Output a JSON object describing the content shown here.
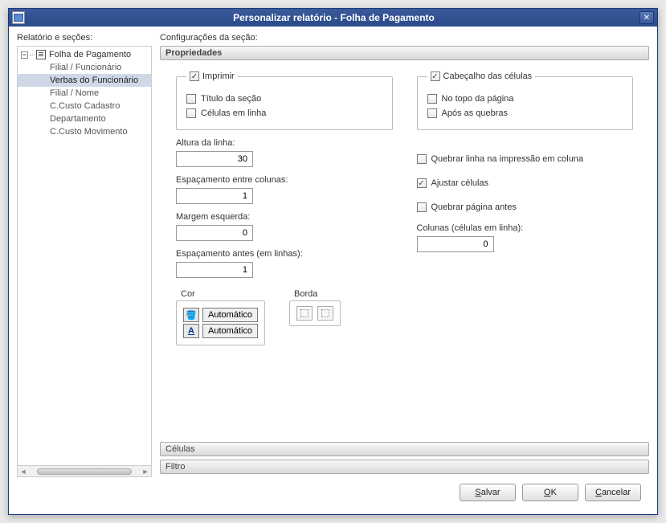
{
  "title": "Personalizar relatório - Folha de Pagamento",
  "labels": {
    "left_header": "Relatório e seções:",
    "right_header": "Configurações da seção:"
  },
  "tree": {
    "root": "Folha de Pagamento",
    "items": [
      "Filial / Funcionário",
      "Verbas do Funcionário",
      "Filial / Nome",
      "C.Custo Cadastro",
      "Departamento",
      "C.Custo Movimento"
    ],
    "selected_index": 1
  },
  "sections": {
    "propriedades": "Propriedades",
    "celulas": "Células",
    "filtro": "Filtro"
  },
  "imprimir": {
    "legend": "Imprimir",
    "titulo": "Título da seção",
    "celulas_linha": "Células em linha"
  },
  "cabecalho": {
    "legend": "Cabeçalho das células",
    "topo": "No topo da página",
    "apos": "Após as quebras"
  },
  "fields": {
    "altura_lbl": "Altura da linha:",
    "altura_val": "30",
    "esp_col_lbl": "Espaçamento entre colunas:",
    "esp_col_val": "1",
    "margem_lbl": "Margem esquerda:",
    "margem_val": "0",
    "esp_antes_lbl": "Espaçamento antes (em linhas):",
    "esp_antes_val": "1",
    "quebrar_linha": "Quebrar linha na impressão em coluna",
    "ajustar": "Ajustar células",
    "quebrar_pagina": "Quebrar página antes",
    "colunas_lbl": "Colunas (células em linha):",
    "colunas_val": "0"
  },
  "cor": {
    "legend": "Cor",
    "auto1": "Automático",
    "auto2": "Automático"
  },
  "borda": {
    "legend": "Borda"
  },
  "buttons": {
    "salvar": "Salvar",
    "salvar_u": "S",
    "ok": "OK",
    "ok_u": "O",
    "ok_rest": "K",
    "cancelar": "Cancelar",
    "cancelar_u": "C"
  }
}
